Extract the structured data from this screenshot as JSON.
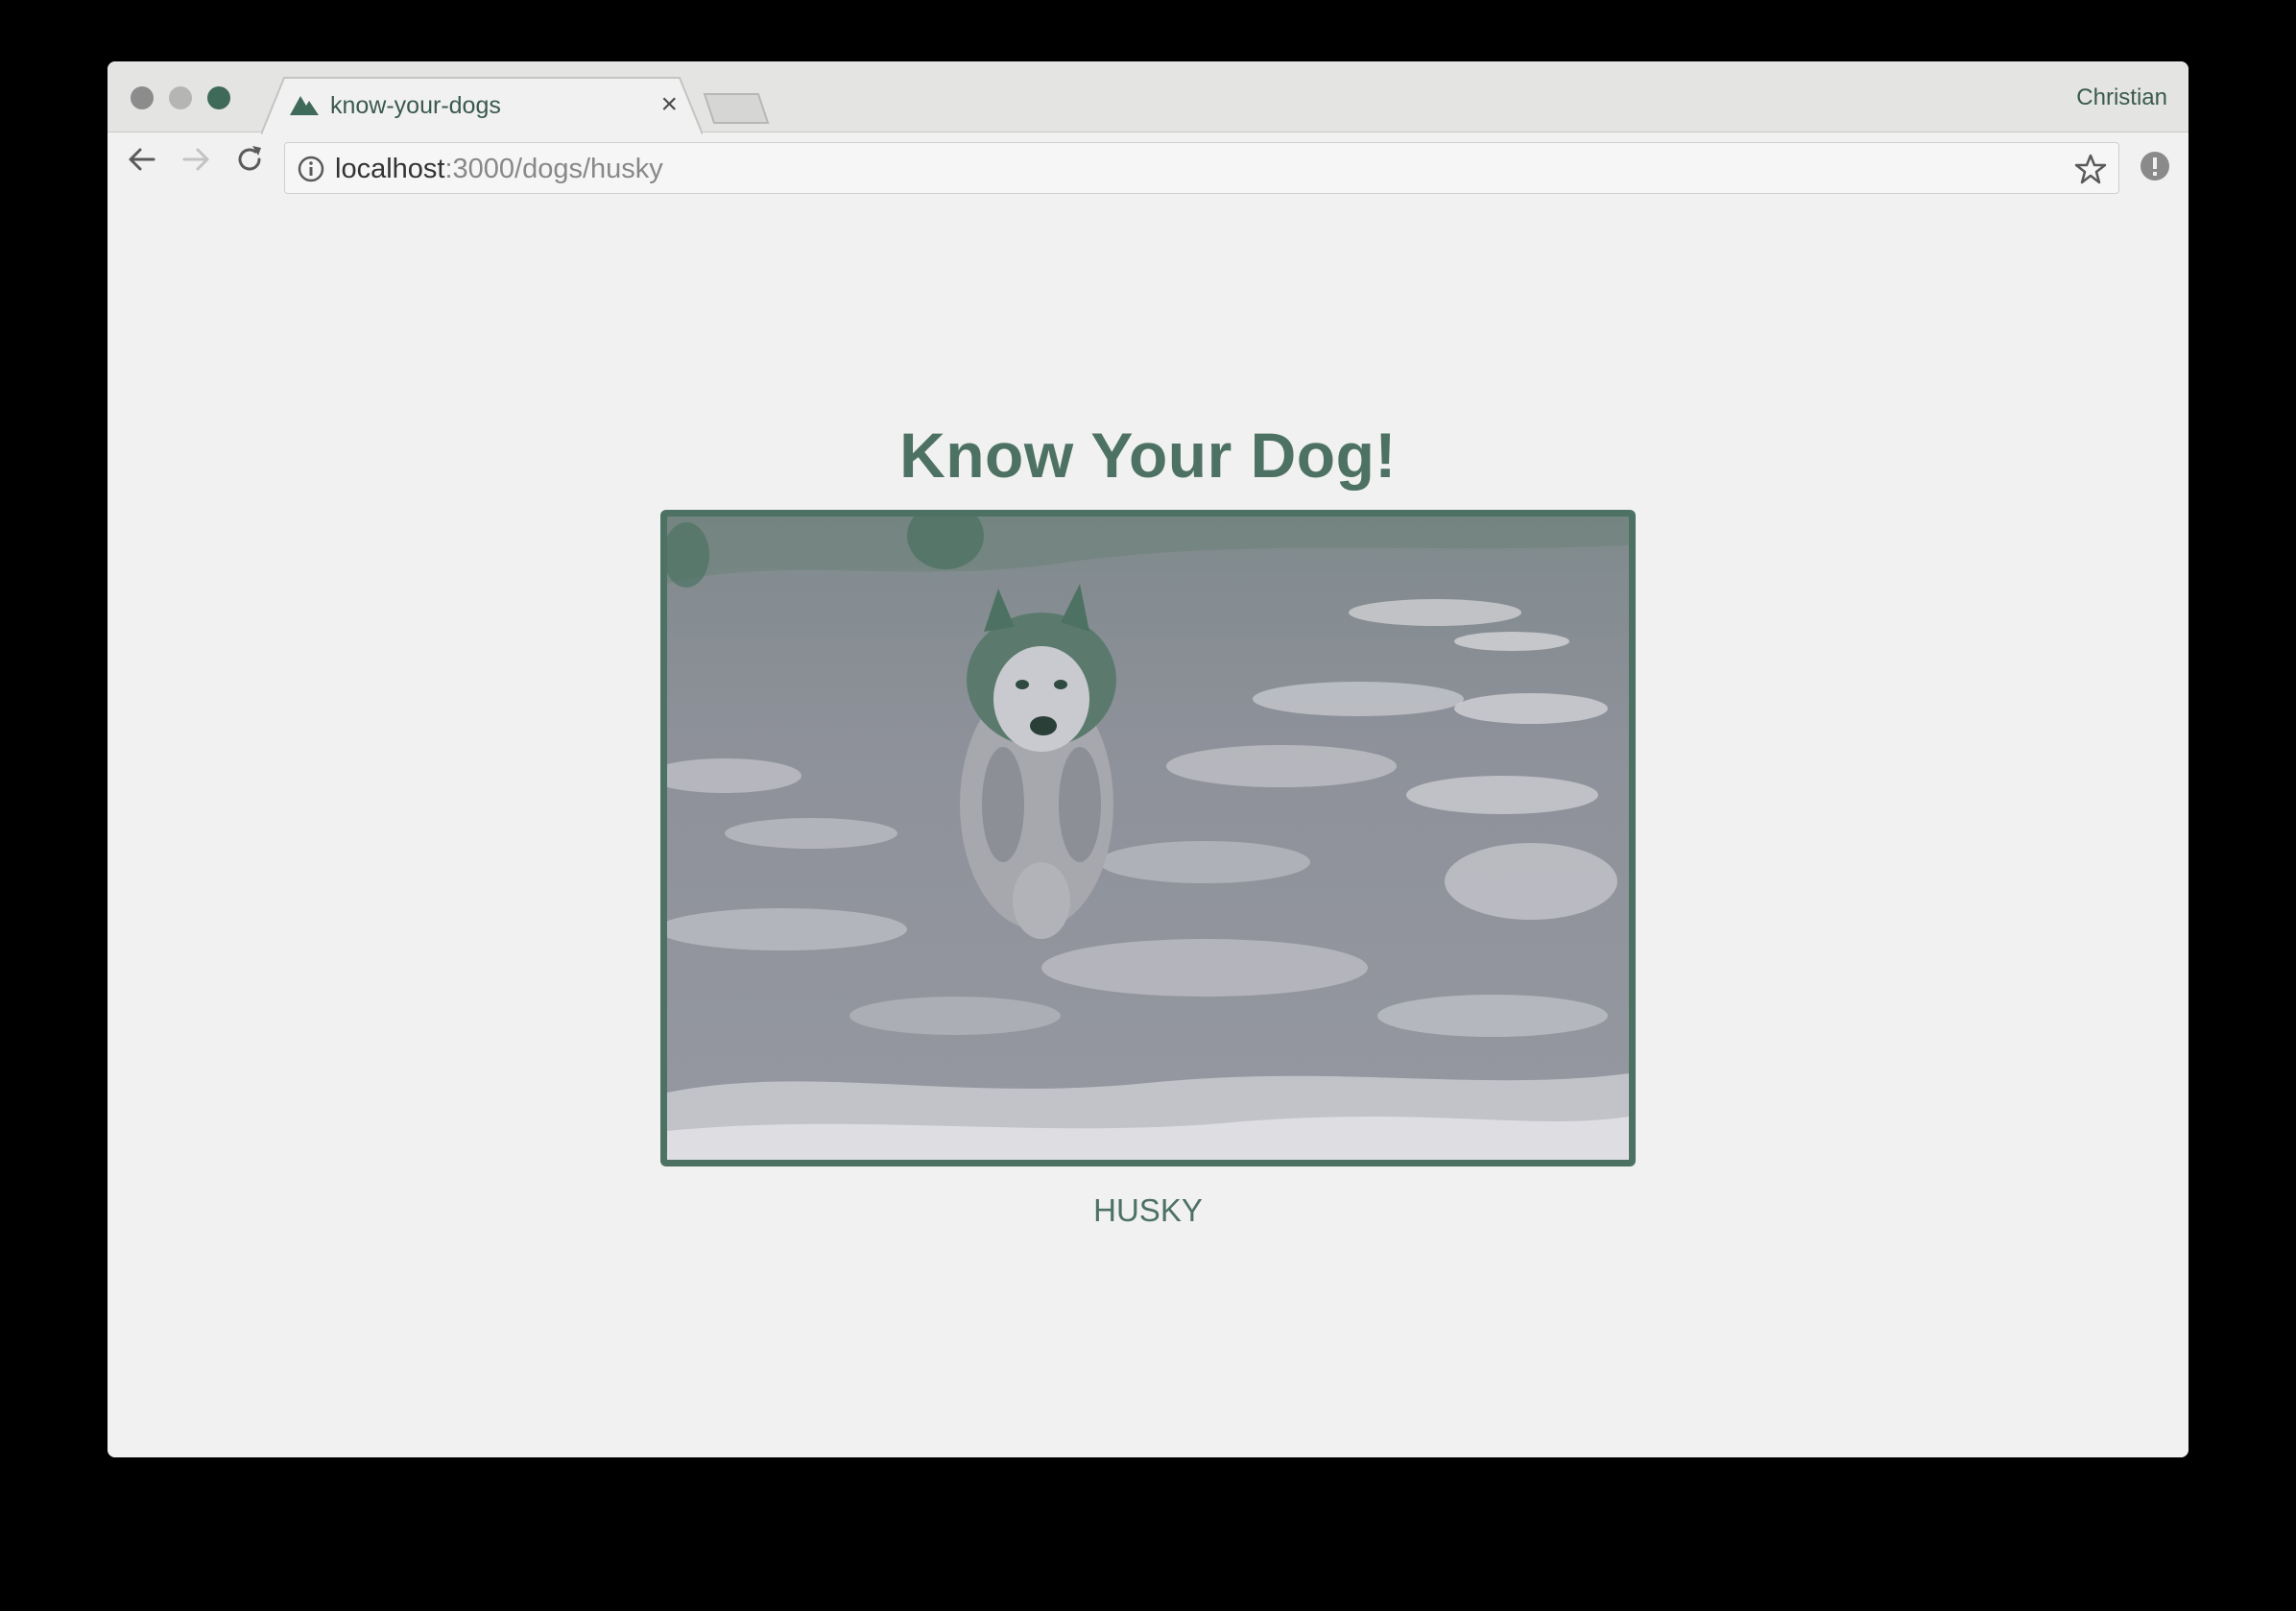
{
  "browser": {
    "tab": {
      "title": "know-your-dogs",
      "close_glyph": "×"
    },
    "profile_name": "Christian",
    "address": {
      "host": "localhost",
      "path": ":3000/dogs/husky"
    }
  },
  "page": {
    "title": "Know Your Dog!",
    "image": {
      "subject": "husky dog running in snow"
    },
    "caption": "HUSKY"
  },
  "colors": {
    "accent": "#4d7263",
    "frame_border": "#4d7263",
    "background": "#f1f1f1"
  },
  "icons": [
    "mountain-favicon-icon",
    "close-icon",
    "back-arrow-icon",
    "forward-arrow-icon",
    "reload-icon",
    "info-icon",
    "star-icon",
    "alert-icon"
  ]
}
